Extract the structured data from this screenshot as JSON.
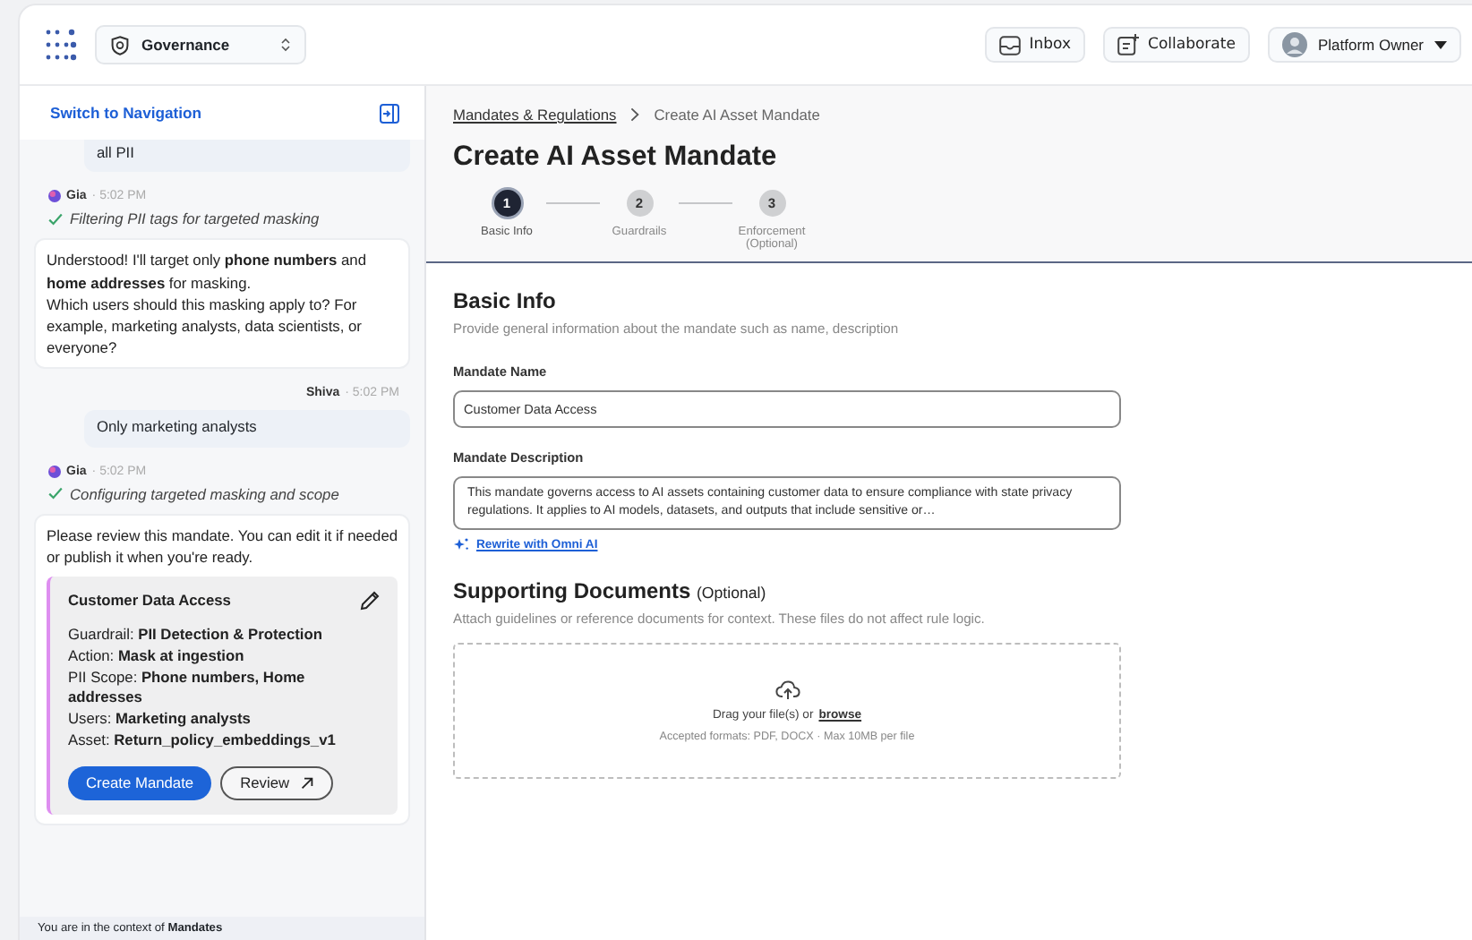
{
  "header": {
    "workspace": "Governance",
    "buttons": [
      {
        "kind": "inbox",
        "label": "Inbox"
      },
      {
        "kind": "collaborate",
        "label": "Collaborate"
      }
    ],
    "user": {
      "name": "Platform Owner"
    }
  },
  "chat": {
    "switch_label": "Switch to Navigation",
    "messages": [
      {
        "kind": "user",
        "text": "all PII"
      },
      {
        "kind": "assistant_meta",
        "name": "Gia",
        "time": "· 5:02 PM"
      },
      {
        "kind": "status",
        "text": "Filtering PII tags for targeted masking"
      },
      {
        "kind": "assistant",
        "lines": [
          "Understood! I'll target only **phone numbers** and **home addresses** for masking.",
          "Which users should this masking apply to? For example, marketing analysts, data scientists, or everyone?"
        ]
      },
      {
        "kind": "user_meta",
        "name": "Shiva",
        "time": "· 5:02 PM"
      },
      {
        "kind": "user",
        "text": "Only marketing analysts"
      },
      {
        "kind": "assistant_meta",
        "name": "Gia",
        "time": "· 5:02 PM"
      },
      {
        "kind": "status",
        "text": "Configuring targeted masking and scope"
      },
      {
        "kind": "mandate",
        "text": "Please review this mandate. You can edit it if needed or publish it when you're ready.",
        "card": {
          "title": "Customer Data Access",
          "fields": [
            "Guardrail: **PII Detection & Protection**",
            "Action: **Mask at ingestion**",
            "PII Scope: **Phone numbers, Home addresses**",
            "Users: **Marketing analysts**",
            "Asset: **Return_policy_embeddings_v1**"
          ],
          "primary": "Create Mandate",
          "secondary": "Review"
        }
      }
    ],
    "context_note": "You are in the context of **Mandates**"
  },
  "form": {
    "breadcrumb": [
      "Mandates & Regulations",
      "Create AI Asset Mandate"
    ],
    "title": "Create AI Asset Mandate",
    "steps": [
      {
        "number": "1",
        "label": "Basic Info",
        "selected": true
      },
      {
        "number": "2",
        "label": "Guardrails",
        "selected": false
      },
      {
        "number": "3",
        "label": "Enforcement (Optional)",
        "selected": false
      }
    ],
    "section_title": "Basic Info",
    "section_desc": "Provide general information about the mandate such as name, description",
    "name_label": "Mandate Name",
    "name_value": "Customer Data Access",
    "desc_label": "Mandate Description",
    "desc_value": "This mandate governs access to AI assets containing customer data to ensure compliance with state privacy regulations. It applies to AI models, datasets, and outputs that include sensitive or…",
    "rewrite_link": "Rewrite with Omni AI",
    "docs_title": "Supporting Documents",
    "docs_optional": "(Optional)",
    "docs_desc": "Attach guidelines or reference documents for context. These files do not affect rule logic.",
    "drop_text": "Drag your file(s) or",
    "browse_link": "browse",
    "drop_hint": "Accepted formats: PDF, DOCX · Max 10MB per file"
  }
}
